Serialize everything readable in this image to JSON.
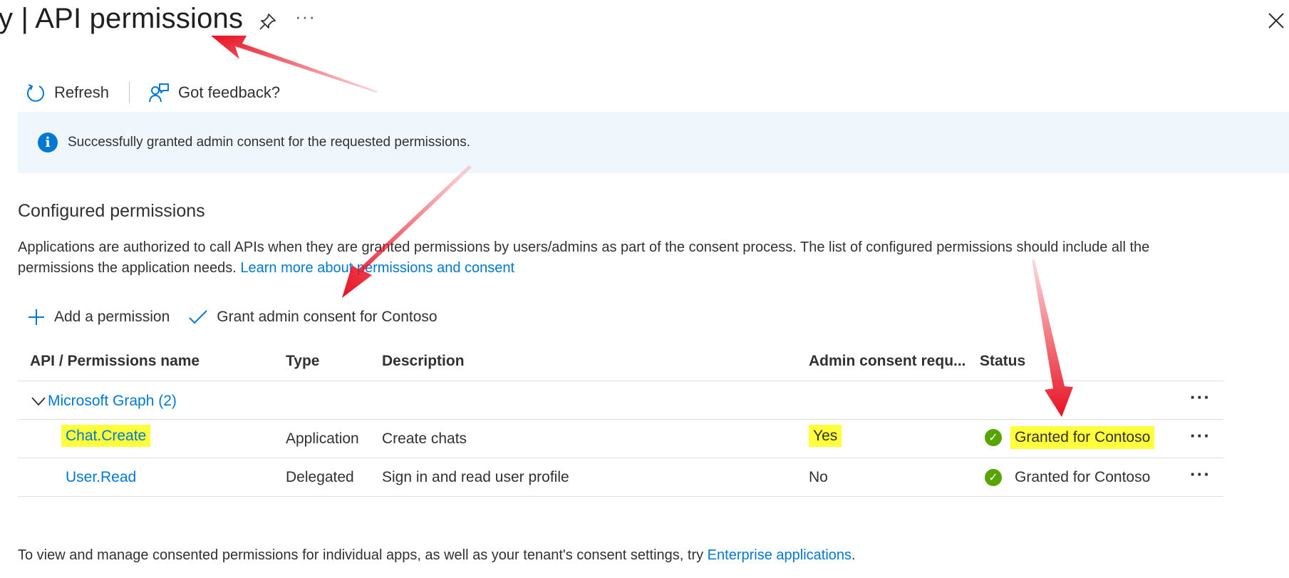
{
  "header": {
    "title": "y | API permissions",
    "more_label": "···"
  },
  "toolbar": {
    "refresh_label": "Refresh",
    "feedback_label": "Got feedback?"
  },
  "banner": {
    "message": "Successfully granted admin consent for the requested permissions."
  },
  "section": {
    "title": "Configured permissions",
    "description": "Applications are authorized to call APIs when they are granted permissions by users/admins as part of the consent process. The list of configured permissions should include all the permissions the application needs. ",
    "learn_more_link": "Learn more about permissions and consent"
  },
  "commands": {
    "add_label": "Add a permission",
    "grant_label": "Grant admin consent for Contoso"
  },
  "table": {
    "headers": [
      "API / Permissions name",
      "Type",
      "Description",
      "Admin consent requ...",
      "Status"
    ],
    "group": {
      "label": "Microsoft Graph (2)",
      "more": "···"
    },
    "rows": [
      {
        "name": "Chat.Create",
        "type": "Application",
        "description": "Create chats",
        "admin_consent": "Yes",
        "status": "Granted for Contoso",
        "more": "···"
      },
      {
        "name": "User.Read",
        "type": "Delegated",
        "description": "Sign in and read user profile",
        "admin_consent": "No",
        "status": "Granted for Contoso",
        "more": "···"
      }
    ]
  },
  "footer": {
    "text": "To view and manage consented permissions for individual apps, as well as your tenant's consent settings, try ",
    "link": "Enterprise applications",
    "end": "."
  },
  "colors": {
    "accent": "#0078d4",
    "highlight": "#ffff3b",
    "success": "#57a300",
    "banner_bg": "#eff6fc",
    "annotation_arrow": "#e81123"
  },
  "icons": [
    "pin-icon",
    "close-icon",
    "refresh-icon",
    "feedback-icon",
    "info-icon",
    "add-icon",
    "checkmark-icon",
    "chevron-down-icon",
    "success-icon"
  ]
}
